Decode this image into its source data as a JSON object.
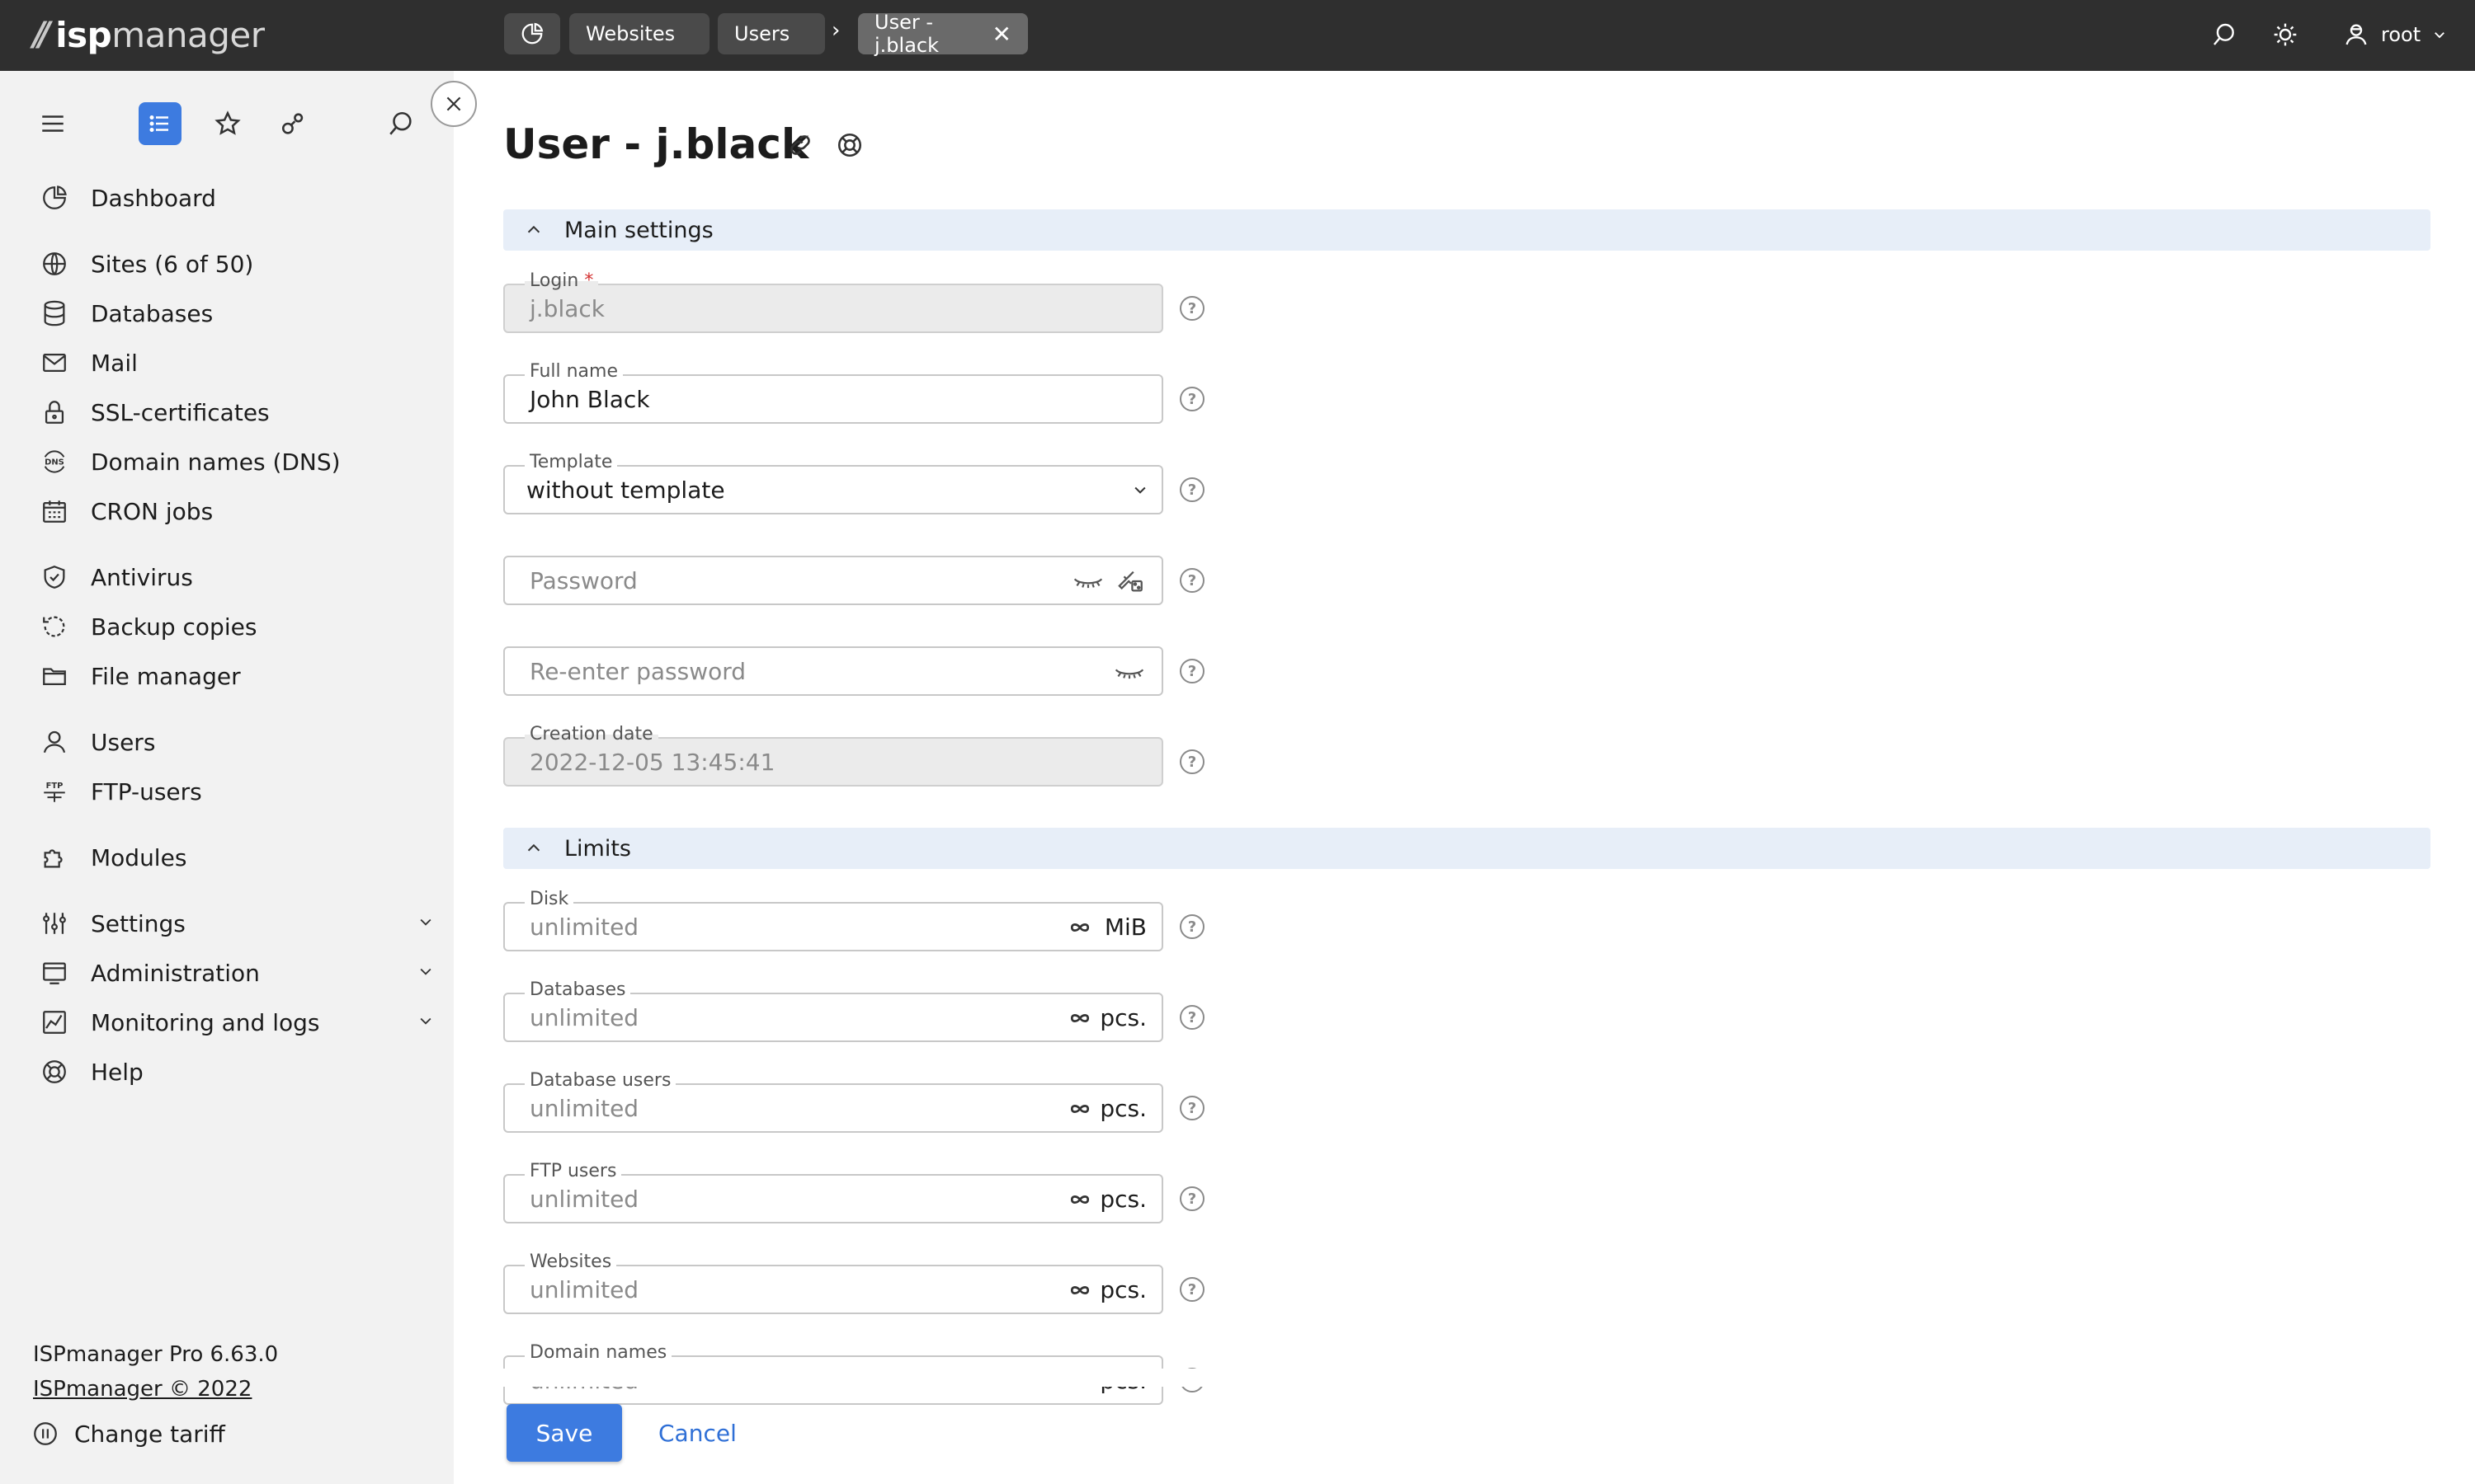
{
  "brand": {
    "logo_prefix": "isp",
    "logo_suffix": "manager"
  },
  "topbar": {
    "tabs": [
      {
        "label": "Websites"
      },
      {
        "label": "Users"
      },
      {
        "label": "User - j.black"
      }
    ],
    "crumb_separator": "›",
    "close_symbol": "✕",
    "user": "root"
  },
  "sidebar": {
    "nav": [
      {
        "label": "Dashboard",
        "icon": "pie-chart-icon"
      },
      {
        "label": "Sites (6 of 50)",
        "icon": "globe-icon"
      },
      {
        "label": "Databases",
        "icon": "database-icon"
      },
      {
        "label": "Mail",
        "icon": "mail-icon"
      },
      {
        "label": "SSL-certificates",
        "icon": "lock-icon"
      },
      {
        "label": "Domain names (DNS)",
        "icon": "dns-icon"
      },
      {
        "label": "CRON jobs",
        "icon": "calendar-icon"
      },
      {
        "label": "Antivirus",
        "icon": "shield-icon"
      },
      {
        "label": "Backup copies",
        "icon": "backup-icon"
      },
      {
        "label": "File manager",
        "icon": "folder-icon"
      },
      {
        "label": "Users",
        "icon": "user-icon"
      },
      {
        "label": "FTP-users",
        "icon": "ftp-icon"
      },
      {
        "label": "Modules",
        "icon": "puzzle-icon"
      },
      {
        "label": "Settings",
        "icon": "sliders-icon"
      },
      {
        "label": "Administration",
        "icon": "server-icon"
      },
      {
        "label": "Monitoring and logs",
        "icon": "chart-icon"
      },
      {
        "label": "Help",
        "icon": "lifebuoy-icon"
      }
    ],
    "version": "ISPmanager Pro 6.63.0",
    "copyright": "ISPmanager © 2022",
    "change_tariff": "Change tariff"
  },
  "page": {
    "title": "User - j.black",
    "main_section": "Main settings",
    "limits_section": "Limits",
    "help_symbol": "?",
    "required_mark": "*",
    "fields": {
      "login": {
        "label": "Login",
        "value": "j.black"
      },
      "fullname": {
        "label": "Full name",
        "value": "John Black"
      },
      "template": {
        "label": "Template",
        "value": "without template"
      },
      "password": {
        "placeholder": "Password"
      },
      "repassword": {
        "placeholder": "Re-enter password"
      },
      "created": {
        "label": "Creation date",
        "value": "2022-12-05 13:45:41"
      }
    },
    "limits": [
      {
        "label": "Disk",
        "value": "unlimited",
        "unit": "MiB"
      },
      {
        "label": "Databases",
        "value": "unlimited",
        "unit": "pcs."
      },
      {
        "label": "Database users",
        "value": "unlimited",
        "unit": "pcs."
      },
      {
        "label": "FTP users",
        "value": "unlimited",
        "unit": "pcs."
      },
      {
        "label": "Websites",
        "value": "unlimited",
        "unit": "pcs."
      },
      {
        "label": "Domain names",
        "value": "unlimited",
        "unit": "pcs."
      }
    ],
    "save": "Save",
    "cancel": "Cancel"
  }
}
